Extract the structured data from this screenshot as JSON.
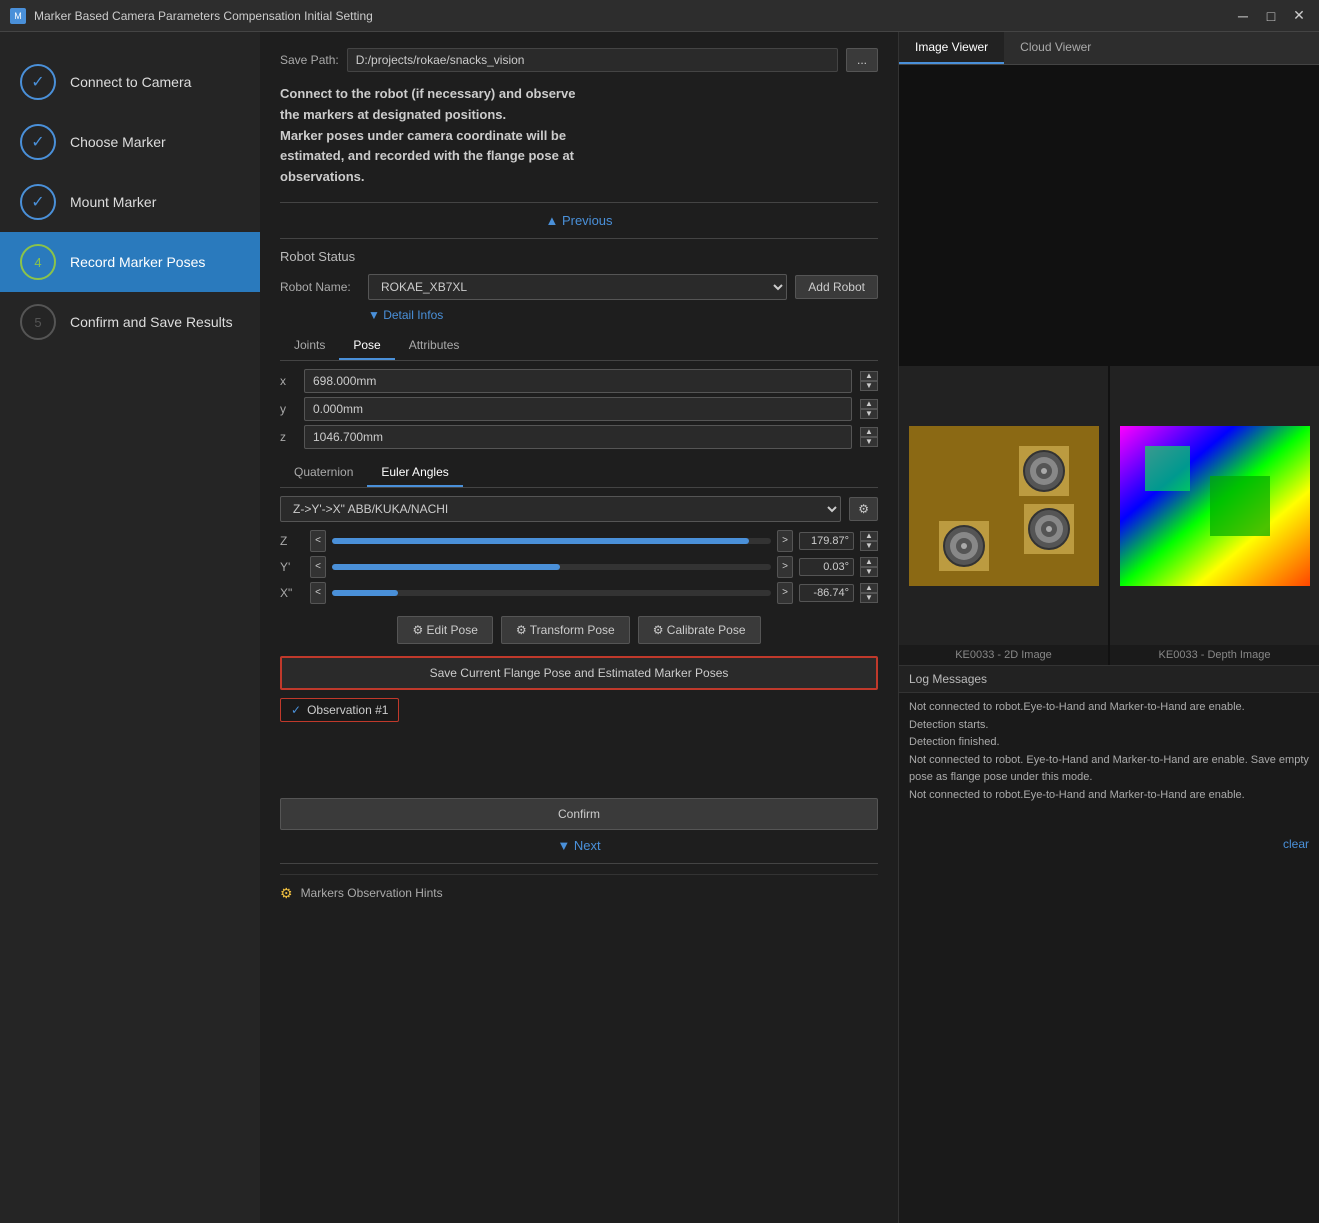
{
  "titleBar": {
    "icon": "M",
    "title": "Marker Based Camera Parameters Compensation Initial Setting",
    "minimize": "─",
    "maximize": "□",
    "close": "✕"
  },
  "sidebar": {
    "items": [
      {
        "id": "connect-to-camera",
        "step": "✓",
        "label": "Connect to Camera",
        "state": "done"
      },
      {
        "id": "choose-marker",
        "step": "✓",
        "label": "Choose Marker",
        "state": "done"
      },
      {
        "id": "mount-marker",
        "step": "✓",
        "label": "Mount Marker",
        "state": "done"
      },
      {
        "id": "record-marker-poses",
        "step": "4",
        "label": "Record Marker Poses",
        "state": "active"
      },
      {
        "id": "confirm-and-save",
        "step": "5",
        "label": "Confirm and Save Results",
        "state": "inactive"
      }
    ]
  },
  "content": {
    "savePath": {
      "label": "Save Path:",
      "value": "D:/projects/rokae/snacks_vision",
      "browseLabel": "..."
    },
    "description": "Connect to the robot (if necessary) and observe\nthe markers at designated positions.\nMarker poses under camera coordinate will be\nestimated, and recorded with the flange pose at\nobservations.",
    "previousBtn": "▲  Previous",
    "robotStatus": {
      "sectionTitle": "Robot Status",
      "nameLabel": "Robot Name:",
      "nameValue": "ROKAE_XB7XL",
      "addRobotBtn": "Add Robot",
      "detailBtn": "▼  Detail Infos"
    },
    "tabs": {
      "joints": "Joints",
      "pose": "Pose",
      "attributes": "Attributes",
      "activeTab": "Pose"
    },
    "pose": {
      "x": {
        "label": "x",
        "value": "698.000mm"
      },
      "y": {
        "label": "y",
        "value": "0.000mm"
      },
      "z": {
        "label": "z",
        "value": "1046.700mm"
      }
    },
    "angleTabs": {
      "quaternion": "Quaternion",
      "euler": "Euler Angles",
      "active": "Euler Angles"
    },
    "eulerSelect": {
      "value": "Z->Y'->X\" ABB/KUKA/NACHI"
    },
    "eulerAngles": [
      {
        "label": "Z",
        "value": "179.87°",
        "fillPercent": 95,
        "ltSymbol": "<",
        "gtSymbol": ">"
      },
      {
        "label": "Y'",
        "value": "0.03°",
        "fillPercent": 52,
        "ltSymbol": "<",
        "gtSymbol": ">"
      },
      {
        "label": "X\"",
        "value": "-86.74°",
        "fillPercent": 15,
        "ltSymbol": "<",
        "gtSymbol": ">"
      }
    ],
    "poseButtons": {
      "editPose": "⚙ Edit Pose",
      "transformPose": "⚙ Transform Pose",
      "calibratePose": "⚙ Calibrate Pose"
    },
    "savePosesBtn": "Save Current Flange Pose and Estimated Marker Poses",
    "observation": {
      "checkmark": "✓",
      "label": "Observation #1"
    },
    "confirmBtn": "Confirm",
    "nextBtn": "▼  Next",
    "hintsLabel": "Markers Observation Hints"
  },
  "rightPanel": {
    "viewerTabs": {
      "imageViewer": "Image Viewer",
      "cloudViewer": "Cloud Viewer",
      "active": "Image Viewer"
    },
    "images": [
      {
        "id": "top-left",
        "label": "",
        "type": "empty"
      },
      {
        "id": "top-right",
        "label": "",
        "type": "empty"
      },
      {
        "id": "bottom-left",
        "label": "KE0033 - 2D Image",
        "type": "markers"
      },
      {
        "id": "bottom-right",
        "label": "KE0033 - Depth Image",
        "type": "depth"
      }
    ]
  },
  "logPanel": {
    "title": "Log Messages",
    "messages": [
      "Not connected to robot.Eye-to-Hand and Marker-to-Hand are enable.",
      "Detection starts.",
      "Detection finished.",
      "Not connected to robot. Eye-to-Hand and Marker-to-Hand are enable. Save empty pose as flange pose under this mode.",
      "Not connected to robot.Eye-to-Hand and Marker-to-Hand are enable."
    ],
    "clearBtn": "clear"
  }
}
